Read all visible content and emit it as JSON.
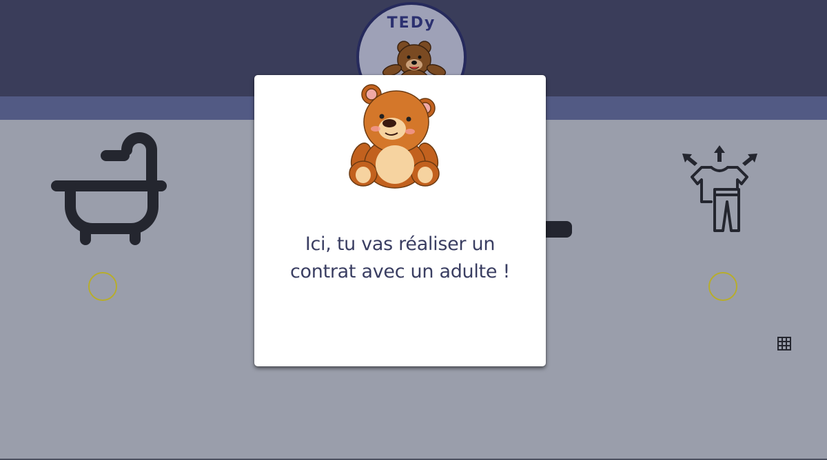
{
  "header": {
    "logo_text": "TEDy"
  },
  "activities": [
    {
      "icon": "bathtub-icon"
    },
    {
      "icon": "clothes-icon"
    }
  ],
  "modal": {
    "line1": "Ici, tu vas réaliser un",
    "line2": "contrat avec un adulte !"
  },
  "colors": {
    "header": "#3a3d5a",
    "stripe": "#525a84",
    "background": "#9a9eab",
    "radio_ring": "#b7ad2c",
    "text": "#3a3e62"
  }
}
